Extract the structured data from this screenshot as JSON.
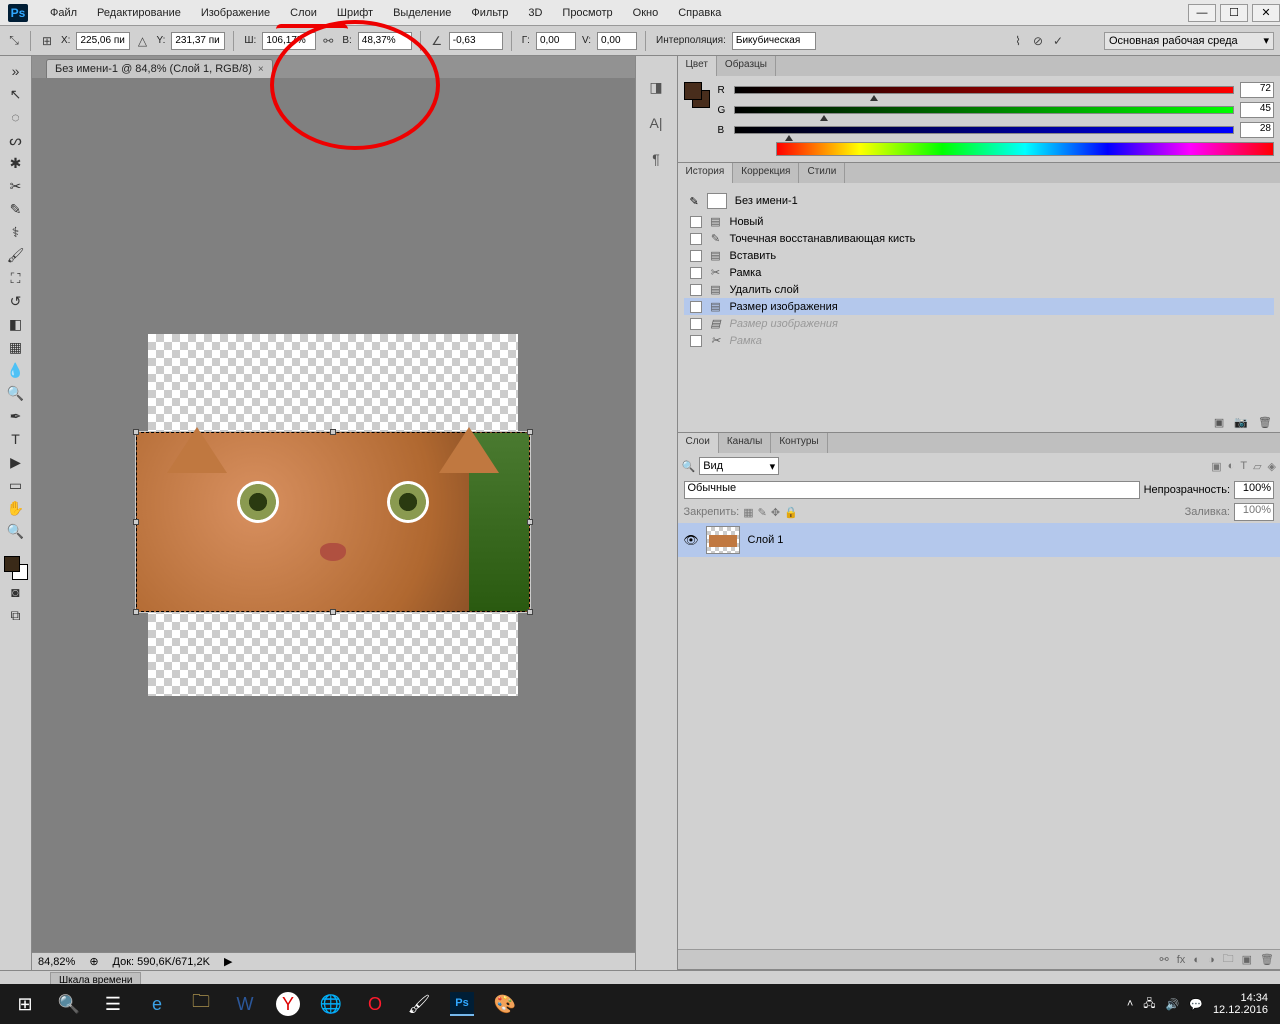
{
  "menu": [
    "Файл",
    "Редактирование",
    "Изображение",
    "Слои",
    "Шрифт",
    "Выделение",
    "Фильтр",
    "3D",
    "Просмотр",
    "Окно",
    "Справка"
  ],
  "options": {
    "x": "225,06 пи",
    "y": "231,37 пи",
    "w": "106,17%",
    "h": "48,37%",
    "angle": "-0,63",
    "hskew": "0,00",
    "vskew": "0,00",
    "interp_label": "Интерполяция:",
    "interp_value": "Бикубическая"
  },
  "workspace": "Основная рабочая среда",
  "doc_tab": "Без имени-1 @ 84,8% (Слой 1, RGB/8)",
  "status": {
    "zoom": "84,82%",
    "doc": "Док: 590,6K/671,2K"
  },
  "color_panel": {
    "tabs": [
      "Цвет",
      "Образцы"
    ],
    "r": "72",
    "g": "45",
    "b": "28"
  },
  "history_panel": {
    "tabs": [
      "История",
      "Коррекция",
      "Стили"
    ],
    "title": "Без имени-1",
    "items": [
      {
        "label": "Новый",
        "icon": "▤"
      },
      {
        "label": "Точечная восстанавливающая кисть",
        "icon": "✎"
      },
      {
        "label": "Вставить",
        "icon": "▤"
      },
      {
        "label": "Рамка",
        "icon": "✂"
      },
      {
        "label": "Удалить слой",
        "icon": "▤"
      },
      {
        "label": "Размер изображения",
        "icon": "▤",
        "sel": true
      },
      {
        "label": "Размер изображения",
        "icon": "▤",
        "dim": true
      },
      {
        "label": "Рамка",
        "icon": "✂",
        "dim": true
      }
    ]
  },
  "layers_panel": {
    "tabs": [
      "Слои",
      "Каналы",
      "Контуры"
    ],
    "search_kind": "Вид",
    "blend": "Обычные",
    "opacity_label": "Непрозрачность:",
    "opacity": "100%",
    "lock_label": "Закрепить:",
    "fill_label": "Заливка:",
    "fill": "100%",
    "layer_name": "Слой 1"
  },
  "timeline": "Шкала времени",
  "tray": {
    "time": "14:34",
    "date": "12.12.2016"
  }
}
